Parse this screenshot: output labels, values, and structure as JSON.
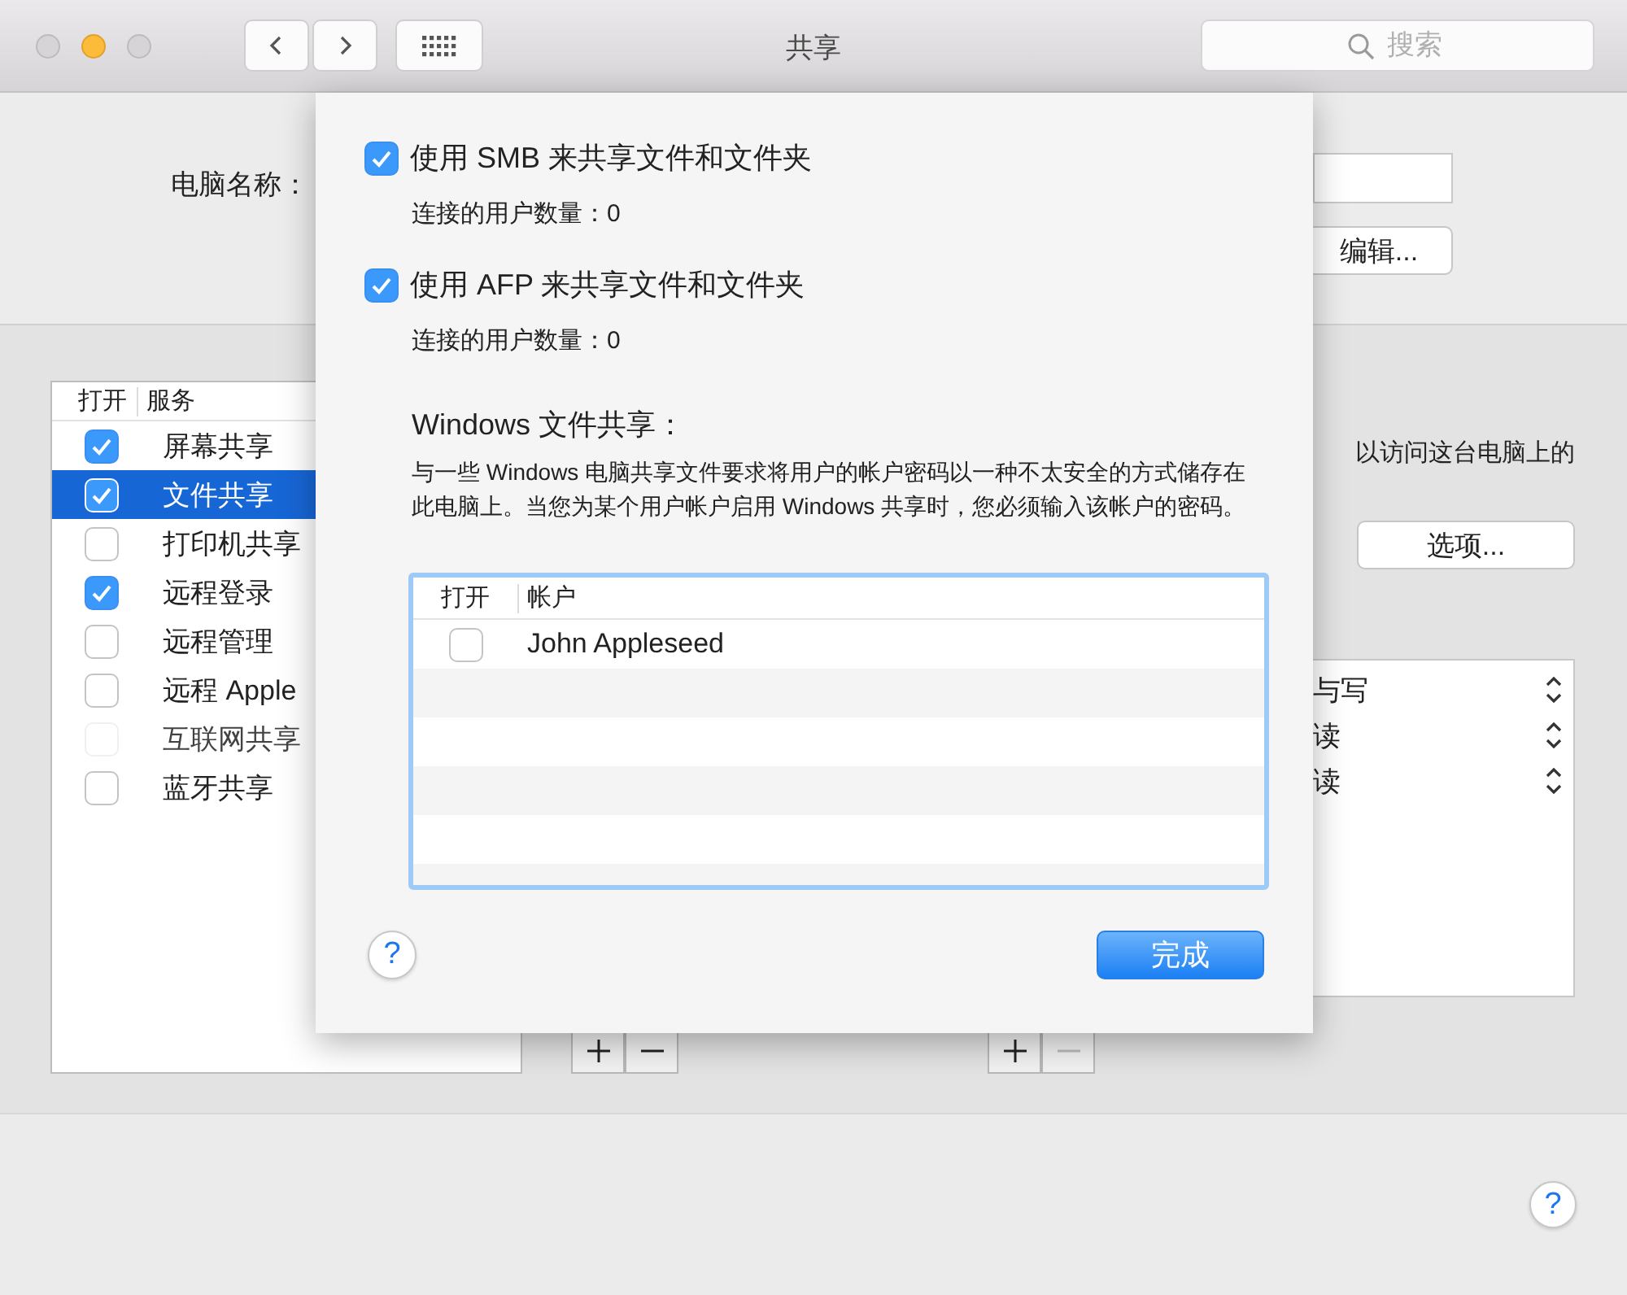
{
  "window": {
    "title": "共享"
  },
  "search": {
    "placeholder": "搜索"
  },
  "computer_name": {
    "label": "电脑名称：",
    "edit_button": "编辑..."
  },
  "services": {
    "columns": [
      "打开",
      "服务"
    ],
    "items": [
      {
        "name": "屏幕共享",
        "checked": true,
        "selected": false,
        "disabled": false
      },
      {
        "name": "文件共享",
        "checked": true,
        "selected": true,
        "disabled": false
      },
      {
        "name": "打印机共享",
        "checked": false,
        "selected": false,
        "disabled": false
      },
      {
        "name": "远程登录",
        "checked": true,
        "selected": false,
        "disabled": false
      },
      {
        "name": "远程管理",
        "checked": false,
        "selected": false,
        "disabled": false
      },
      {
        "name": "远程 Apple",
        "checked": false,
        "selected": false,
        "disabled": false
      },
      {
        "name": "互联网共享",
        "checked": false,
        "selected": false,
        "disabled": true
      },
      {
        "name": "蓝牙共享",
        "checked": false,
        "selected": false,
        "disabled": false
      }
    ]
  },
  "access_note": "以访问这台电脑上的",
  "options_button": "选项...",
  "permissions": [
    "与写",
    "读",
    "读"
  ],
  "list_buttons": [
    {
      "remove_disabled": false
    },
    {
      "remove_disabled": true
    }
  ],
  "sheet": {
    "options": [
      {
        "label": "使用 SMB 来共享文件和文件夹",
        "checked": true,
        "connected_users": "连接的用户数量：0"
      },
      {
        "label": "使用 AFP 来共享文件和文件夹",
        "checked": true,
        "connected_users": "连接的用户数量：0"
      }
    ],
    "windows_title": "Windows 文件共享：",
    "windows_note": "与一些 Windows 电脑共享文件要求将用户的帐户密码以一种不太安全的方式储存在此电脑上。当您为某个用户帐户启用 Windows 共享时，您必须输入该帐户的密码。",
    "accounts": {
      "columns": [
        "打开",
        "帐户"
      ],
      "rows": [
        {
          "name": "John Appleseed",
          "checked": false
        }
      ]
    },
    "help_button": "?",
    "done_button": "完成"
  },
  "help_button": "?"
}
